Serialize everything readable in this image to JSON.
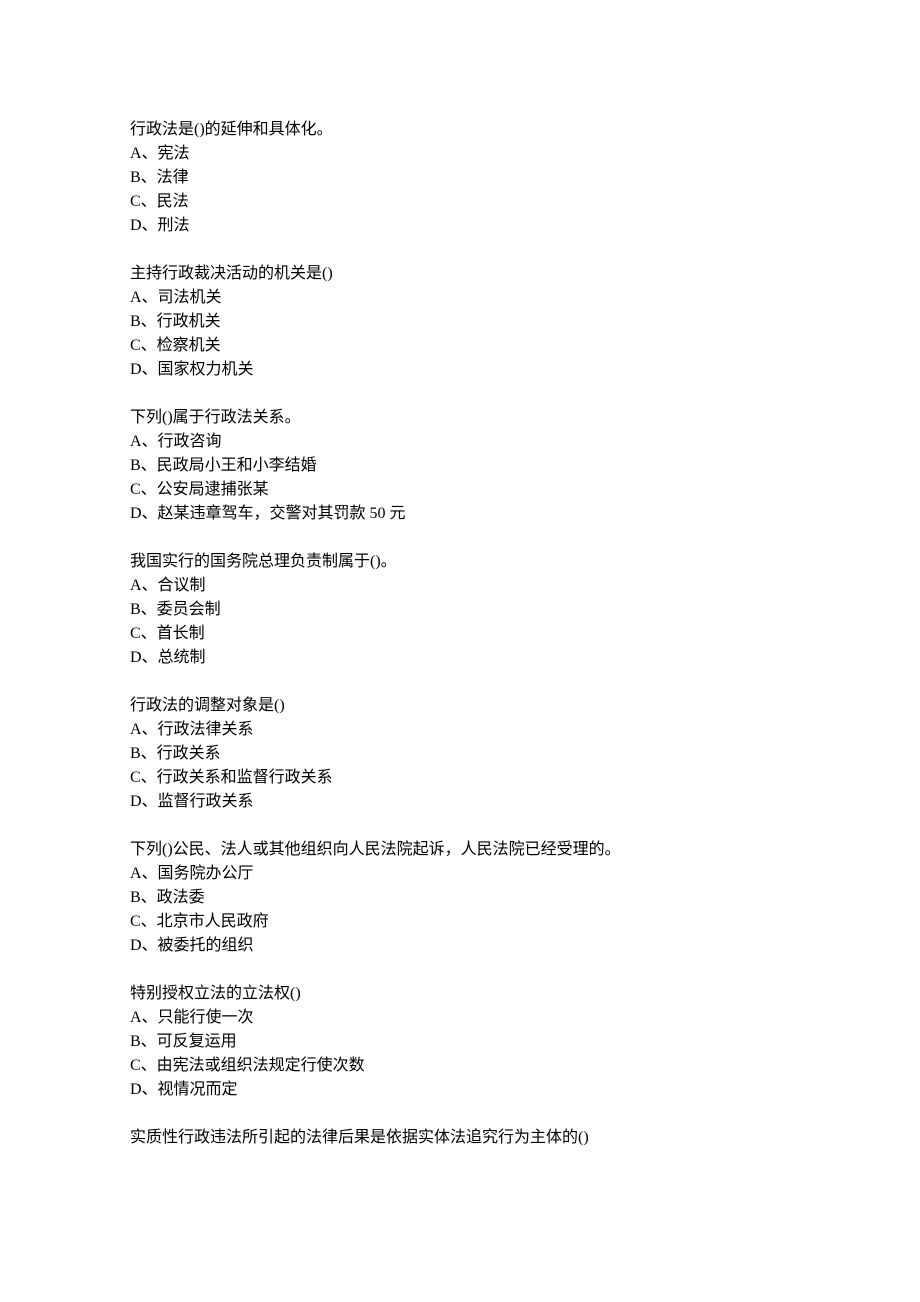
{
  "questions": [
    {
      "stem": "行政法是()的延伸和具体化。",
      "options": [
        "A、宪法",
        "B、法律",
        "C、民法",
        "D、刑法"
      ]
    },
    {
      "stem": "主持行政裁决活动的机关是()",
      "options": [
        "A、司法机关",
        "B、行政机关",
        "C、检察机关",
        "D、国家权力机关"
      ]
    },
    {
      "stem": "下列()属于行政法关系。",
      "options": [
        "A、行政咨询",
        "B、民政局小王和小李结婚",
        "C、公安局逮捕张某",
        "D、赵某违章驾车，交警对其罚款 50 元"
      ]
    },
    {
      "stem": "我国实行的国务院总理负责制属于()。",
      "options": [
        "A、合议制",
        "B、委员会制",
        "C、首长制",
        "D、总统制"
      ]
    },
    {
      "stem": "行政法的调整对象是()",
      "options": [
        "A、行政法律关系",
        "B、行政关系",
        "C、行政关系和监督行政关系",
        "D、监督行政关系"
      ]
    },
    {
      "stem": "下列()公民、法人或其他组织向人民法院起诉，人民法院已经受理的。",
      "options": [
        "A、国务院办公厅",
        "B、政法委",
        "C、北京市人民政府",
        "D、被委托的组织"
      ]
    },
    {
      "stem": "特别授权立法的立法权()",
      "options": [
        "A、只能行使一次",
        "B、可反复运用",
        "C、由宪法或组织法规定行使次数",
        "D、视情况而定"
      ]
    },
    {
      "stem": "实质性行政违法所引起的法律后果是依据实体法追究行为主体的()",
      "options": []
    }
  ]
}
